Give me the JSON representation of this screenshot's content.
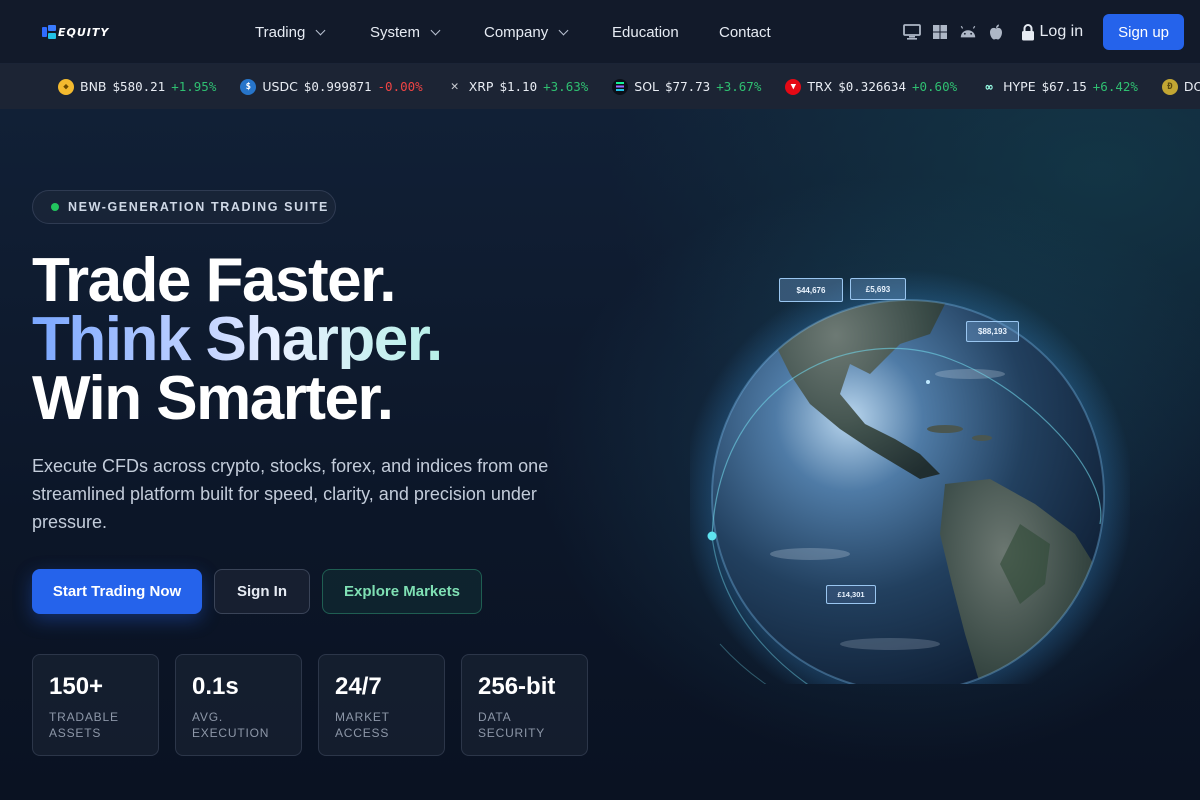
{
  "brand": {
    "name": "EQUITY"
  },
  "nav": {
    "links": [
      {
        "label": "Trading",
        "dropdown": true
      },
      {
        "label": "System",
        "dropdown": true
      },
      {
        "label": "Company",
        "dropdown": true
      },
      {
        "label": "Education",
        "dropdown": false
      },
      {
        "label": "Contact",
        "dropdown": false
      }
    ],
    "platform_icons": [
      "desktop-icon",
      "windows-icon",
      "android-icon",
      "apple-icon"
    ],
    "login_label": "Log in",
    "signup_label": "Sign up"
  },
  "ticker": {
    "items": [
      {
        "symbol": "BNB",
        "price": "$580.21",
        "change": "+1.95%",
        "direction": "up",
        "color": "#f3ba2f",
        "icon": "bnb-icon"
      },
      {
        "symbol": "USDC",
        "price": "$0.999871",
        "change": "-0.00%",
        "direction": "down",
        "color": "#2775ca",
        "icon": "usdc-icon"
      },
      {
        "symbol": "XRP",
        "price": "$1.10",
        "change": "+3.63%",
        "direction": "up",
        "color": "#c9ccd2",
        "icon": "xrp-icon"
      },
      {
        "symbol": "SOL",
        "price": "$77.73",
        "change": "+3.67%",
        "direction": "up",
        "color": "#14f195",
        "icon": "sol-icon"
      },
      {
        "symbol": "TRX",
        "price": "$0.326634",
        "change": "+0.60%",
        "direction": "up",
        "color": "#e50915",
        "icon": "trx-icon"
      },
      {
        "symbol": "HYPE",
        "price": "$67.15",
        "change": "+6.42%",
        "direction": "up",
        "color": "#97fce4",
        "icon": "hype-icon"
      },
      {
        "symbol": "DO",
        "price": "",
        "change": "",
        "direction": "up",
        "color": "#c2a633",
        "icon": "doge-icon"
      }
    ]
  },
  "hero": {
    "badge": "NEW-GENERATION TRADING SUITE",
    "headline": [
      "Trade Faster.",
      "Think Sharper.",
      "Win Smarter."
    ],
    "lead": "Execute CFDs across crypto, stocks, forex, and indices from one streamlined platform built for speed, clarity, and precision under pressure.",
    "buttons": {
      "primary": "Start Trading Now",
      "secondary": "Sign In",
      "tertiary": "Explore Markets"
    },
    "stats": [
      {
        "value": "150+",
        "label_line1": "TRADABLE",
        "label_line2": "ASSETS"
      },
      {
        "value": "0.1s",
        "label_line1": "AVG.",
        "label_line2": "EXECUTION"
      },
      {
        "value": "24/7",
        "label_line1": "MARKET",
        "label_line2": "ACCESS"
      },
      {
        "value": "256-bit",
        "label_line1": "DATA",
        "label_line2": "SECURITY"
      }
    ],
    "globe_tags": [
      "$44,676",
      "£5,693",
      "$88,193",
      "£14,301"
    ]
  },
  "colors": {
    "accent": "#2563eb",
    "up": "#2fbf71",
    "down": "#ef4444",
    "badge_dot": "#22c55e"
  }
}
